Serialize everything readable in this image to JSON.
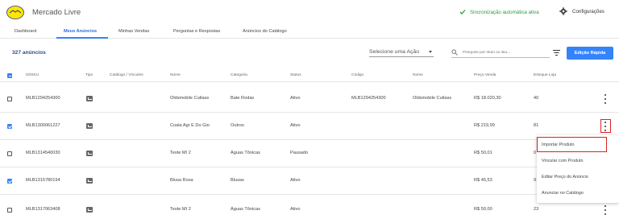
{
  "app": {
    "title": "Mercado Livre"
  },
  "header": {
    "sync_status": "Sincronização automática ativa",
    "settings_label": "Configurações"
  },
  "tabs": [
    {
      "label": "Dashboard"
    },
    {
      "label": "Meus Anúncios"
    },
    {
      "label": "Minhas Vendas"
    },
    {
      "label": "Perguntas e Respostas"
    },
    {
      "label": "Anúncios do Catálogo"
    }
  ],
  "toolbar": {
    "count": "327 anúncios",
    "action_select": "Selecione uma Ação",
    "search_placeholder": "Pesquise por título ou sku...",
    "quick_edit": "Edição Rápida"
  },
  "table": {
    "headers": [
      "ID/SKU",
      "Tipo",
      "Catálogo / Vínculos",
      "Nome",
      "Categoria",
      "Status",
      "Código",
      "Nome",
      "Preço Venda",
      "Estoque Loja"
    ],
    "rows": [
      {
        "checked": false,
        "id": "MLB1294254300",
        "nome": "Oldsmobile Cutlass",
        "categoria": "Bate Rodas",
        "status": "Ativo",
        "codigo": "MLB1294254300",
        "nome2": "Oldsmobile Cutlass",
        "preco": "R$ 18.020,30",
        "estoque": "40"
      },
      {
        "checked": true,
        "id": "MLB1300061227",
        "nome": "Coala Agr E Do Gio",
        "categoria": "Outros",
        "status": "Ativo",
        "codigo": "",
        "nome2": "",
        "preco": "R$ 219,99",
        "estoque": "81"
      },
      {
        "checked": false,
        "id": "MLB1314540030",
        "nome": "Teste MI 2",
        "categoria": "Águas Tônicas",
        "status": "Pausado",
        "codigo": "",
        "nome2": "",
        "preco": "R$ 50,01",
        "estoque": "0"
      },
      {
        "checked": true,
        "id": "MLB1315780194",
        "nome": "Blusa Rosa",
        "categoria": "Blusas",
        "status": "Ativo",
        "codigo": "",
        "nome2": "",
        "preco": "R$ 45,53",
        "estoque": "9"
      },
      {
        "checked": false,
        "id": "MLB1317063408",
        "nome": "Teste MI 2",
        "categoria": "Águas Tônicas",
        "status": "Ativo",
        "codigo": "",
        "nome2": "",
        "preco": "R$ 50,00",
        "estoque": "23"
      }
    ]
  },
  "row_menu": {
    "items": [
      "Importar Produto",
      "Vincular com Produto",
      "Editar Preço do Anúncio",
      "Anunciar no Catálogo"
    ]
  },
  "colors": {
    "accent": "#3483fa",
    "success": "#2e9b3a",
    "highlight": "#dd2222",
    "brand": "#ffe600"
  }
}
